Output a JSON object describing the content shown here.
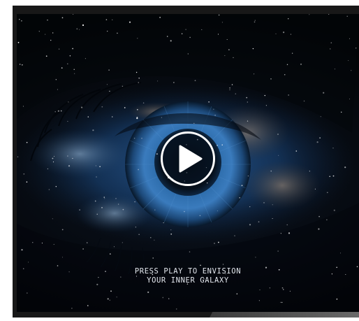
{
  "player": {
    "caption_line1": "PRESS PLAY TO ENVISION",
    "caption_line2": "YOUR INNER GALAXY",
    "play_icon": "play-icon"
  },
  "colors": {
    "background": "#05080d",
    "iris": "#3a76b8",
    "caption": "#e4e8ee",
    "play_button_border": "#ffffff"
  }
}
